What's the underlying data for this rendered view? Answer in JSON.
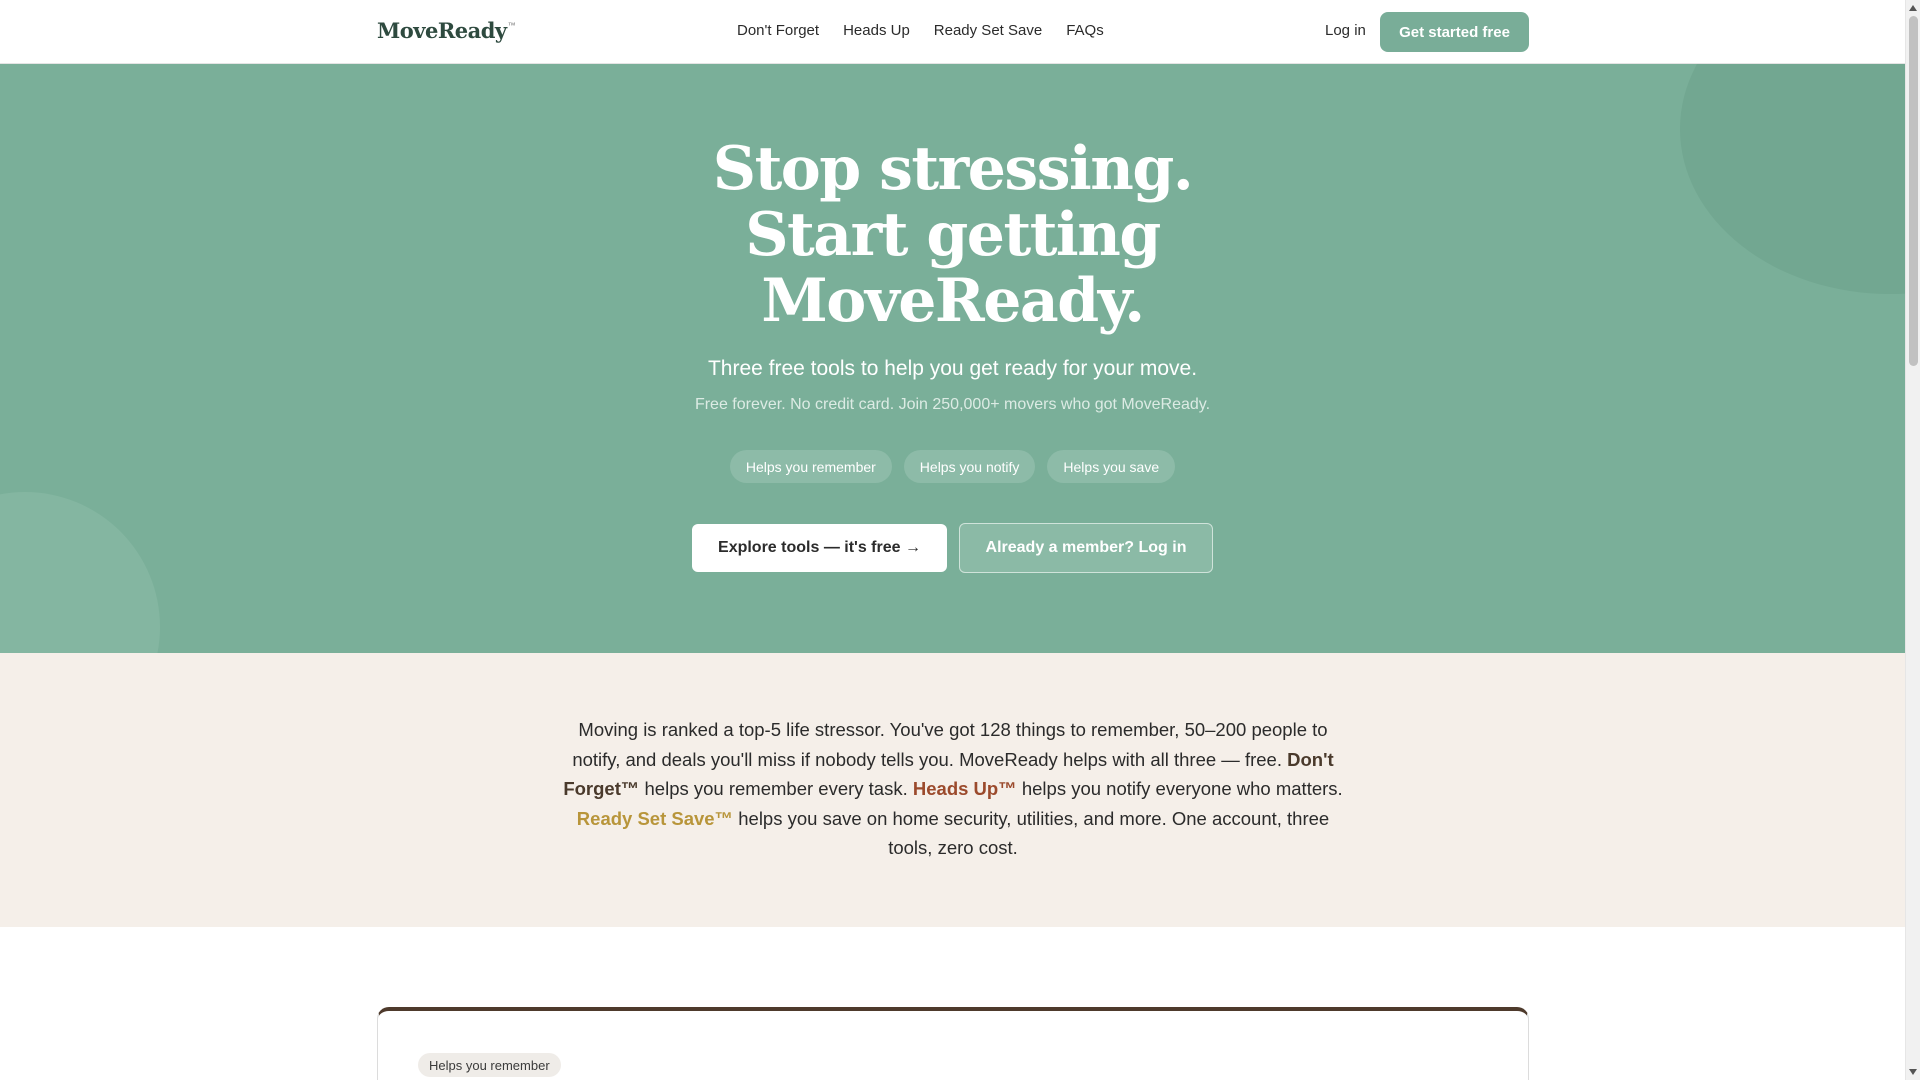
{
  "header": {
    "logo": "MoveReady",
    "logo_tm": "™",
    "nav": [
      "Don't Forget",
      "Heads Up",
      "Ready Set Save",
      "FAQs"
    ],
    "login": "Log in",
    "cta": "Get started free"
  },
  "hero": {
    "title_lines": [
      "Stop stressing.",
      "Start getting",
      "MoveReady."
    ],
    "subtitle": "Three free tools to help you get ready for your move.",
    "note": "Free forever. No credit card. Join 250,000+ movers who got MoveReady.",
    "pills": [
      "Helps you remember",
      "Helps you notify",
      "Helps you save"
    ],
    "primary_button": "Explore tools — it's free →",
    "secondary_button": "Already a member? Log in"
  },
  "intro": {
    "part1": "Moving is ranked a top-5 life stressor. You've got 128 things to remember, 50–200 people to notify, and deals you'll miss if nobody tells you. MoveReady helps with all three — free. ",
    "dont_forget": "Don't Forget™",
    "part2": " helps you remember every task. ",
    "heads_up": "Heads Up™",
    "part3": " helps you notify everyone who matters. ",
    "ready_set_save": "Ready Set Save™",
    "part4": " helps you save on home security, utilities, and more. One account, three tools, zero cost."
  },
  "card": {
    "pill": "Helps you remember"
  },
  "colors": {
    "hero_bg": "#7aaf99",
    "accent_green": "#79ad98",
    "intro_bg": "#f5efe9",
    "dont_forget": "#4a3a2c",
    "heads_up": "#9b4a2c",
    "ready_set_save": "#b8953a"
  }
}
